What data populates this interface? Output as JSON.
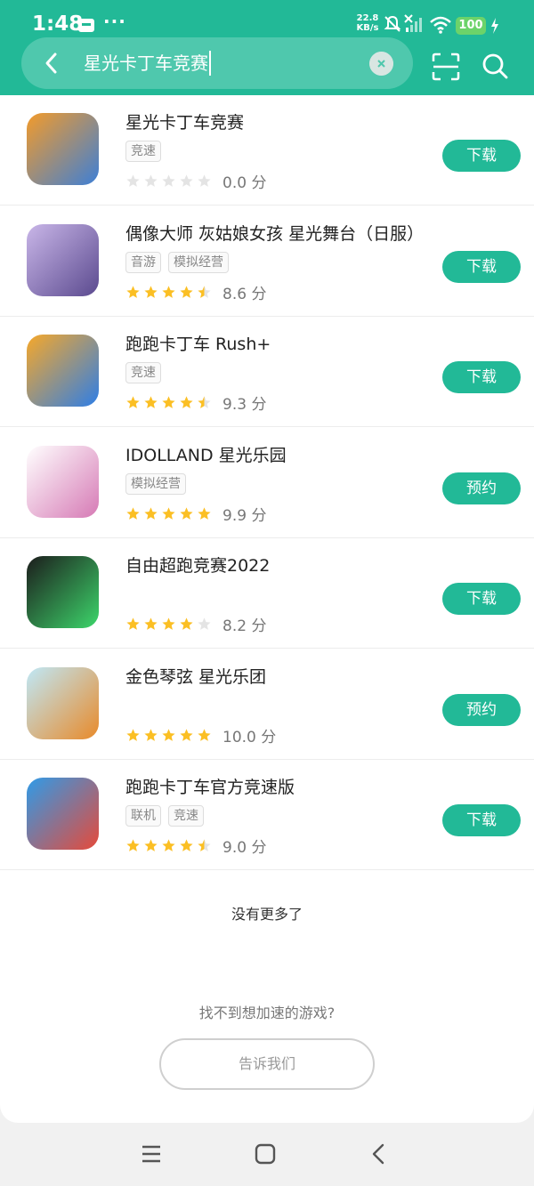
{
  "status_bar": {
    "time": "1:48",
    "more": "···",
    "net_speed_value": "22.8",
    "net_speed_unit": "KB/s",
    "battery": "100"
  },
  "search": {
    "query": "星光卡丁车竞赛"
  },
  "results": [
    {
      "name": "星光卡丁车竞赛",
      "tags": [
        "竞速"
      ],
      "stars": 0,
      "score": "0.0 分",
      "action": "下载",
      "icon_colors": [
        "#f39b2a",
        "#3d7fd6"
      ]
    },
    {
      "name": "偶像大师 灰姑娘女孩 星光舞台（日服）",
      "tags": [
        "音游",
        "模拟经营"
      ],
      "stars": 4.5,
      "score": "8.6 分",
      "action": "下载",
      "icon_colors": [
        "#c9b6e8",
        "#5b4a8f"
      ]
    },
    {
      "name": "跑跑卡丁车 Rush+",
      "tags": [
        "竞速"
      ],
      "stars": 4.5,
      "score": "9.3 分",
      "action": "下载",
      "icon_colors": [
        "#f7a829",
        "#2e7ee6"
      ]
    },
    {
      "name": "IDOLLAND 星光乐园",
      "tags": [
        "模拟经营"
      ],
      "stars": 5,
      "score": "9.9 分",
      "action": "预约",
      "icon_colors": [
        "#ffffff",
        "#d67ab5"
      ]
    },
    {
      "name": "自由超跑竞赛2022",
      "tags": [],
      "stars": 4,
      "score": "8.2 分",
      "action": "下载",
      "icon_colors": [
        "#1c1c1c",
        "#3dd66b"
      ]
    },
    {
      "name": "金色琴弦 星光乐团",
      "tags": [],
      "stars": 5,
      "score": "10.0 分",
      "action": "预约",
      "icon_colors": [
        "#bfe8f7",
        "#e88a2a"
      ]
    },
    {
      "name": "跑跑卡丁车官方竞速版",
      "tags": [
        "联机",
        "竞速"
      ],
      "stars": 4.5,
      "score": "9.0 分",
      "action": "下载",
      "icon_colors": [
        "#2f9be8",
        "#e64a3a"
      ]
    }
  ],
  "footer": {
    "no_more": "没有更多了",
    "cant_find": "找不到想加速的游戏?",
    "tell_us": "告诉我们"
  },
  "colors": {
    "brand": "#22b997",
    "star_on": "#fbbf24",
    "star_off": "#e4e4e4"
  }
}
